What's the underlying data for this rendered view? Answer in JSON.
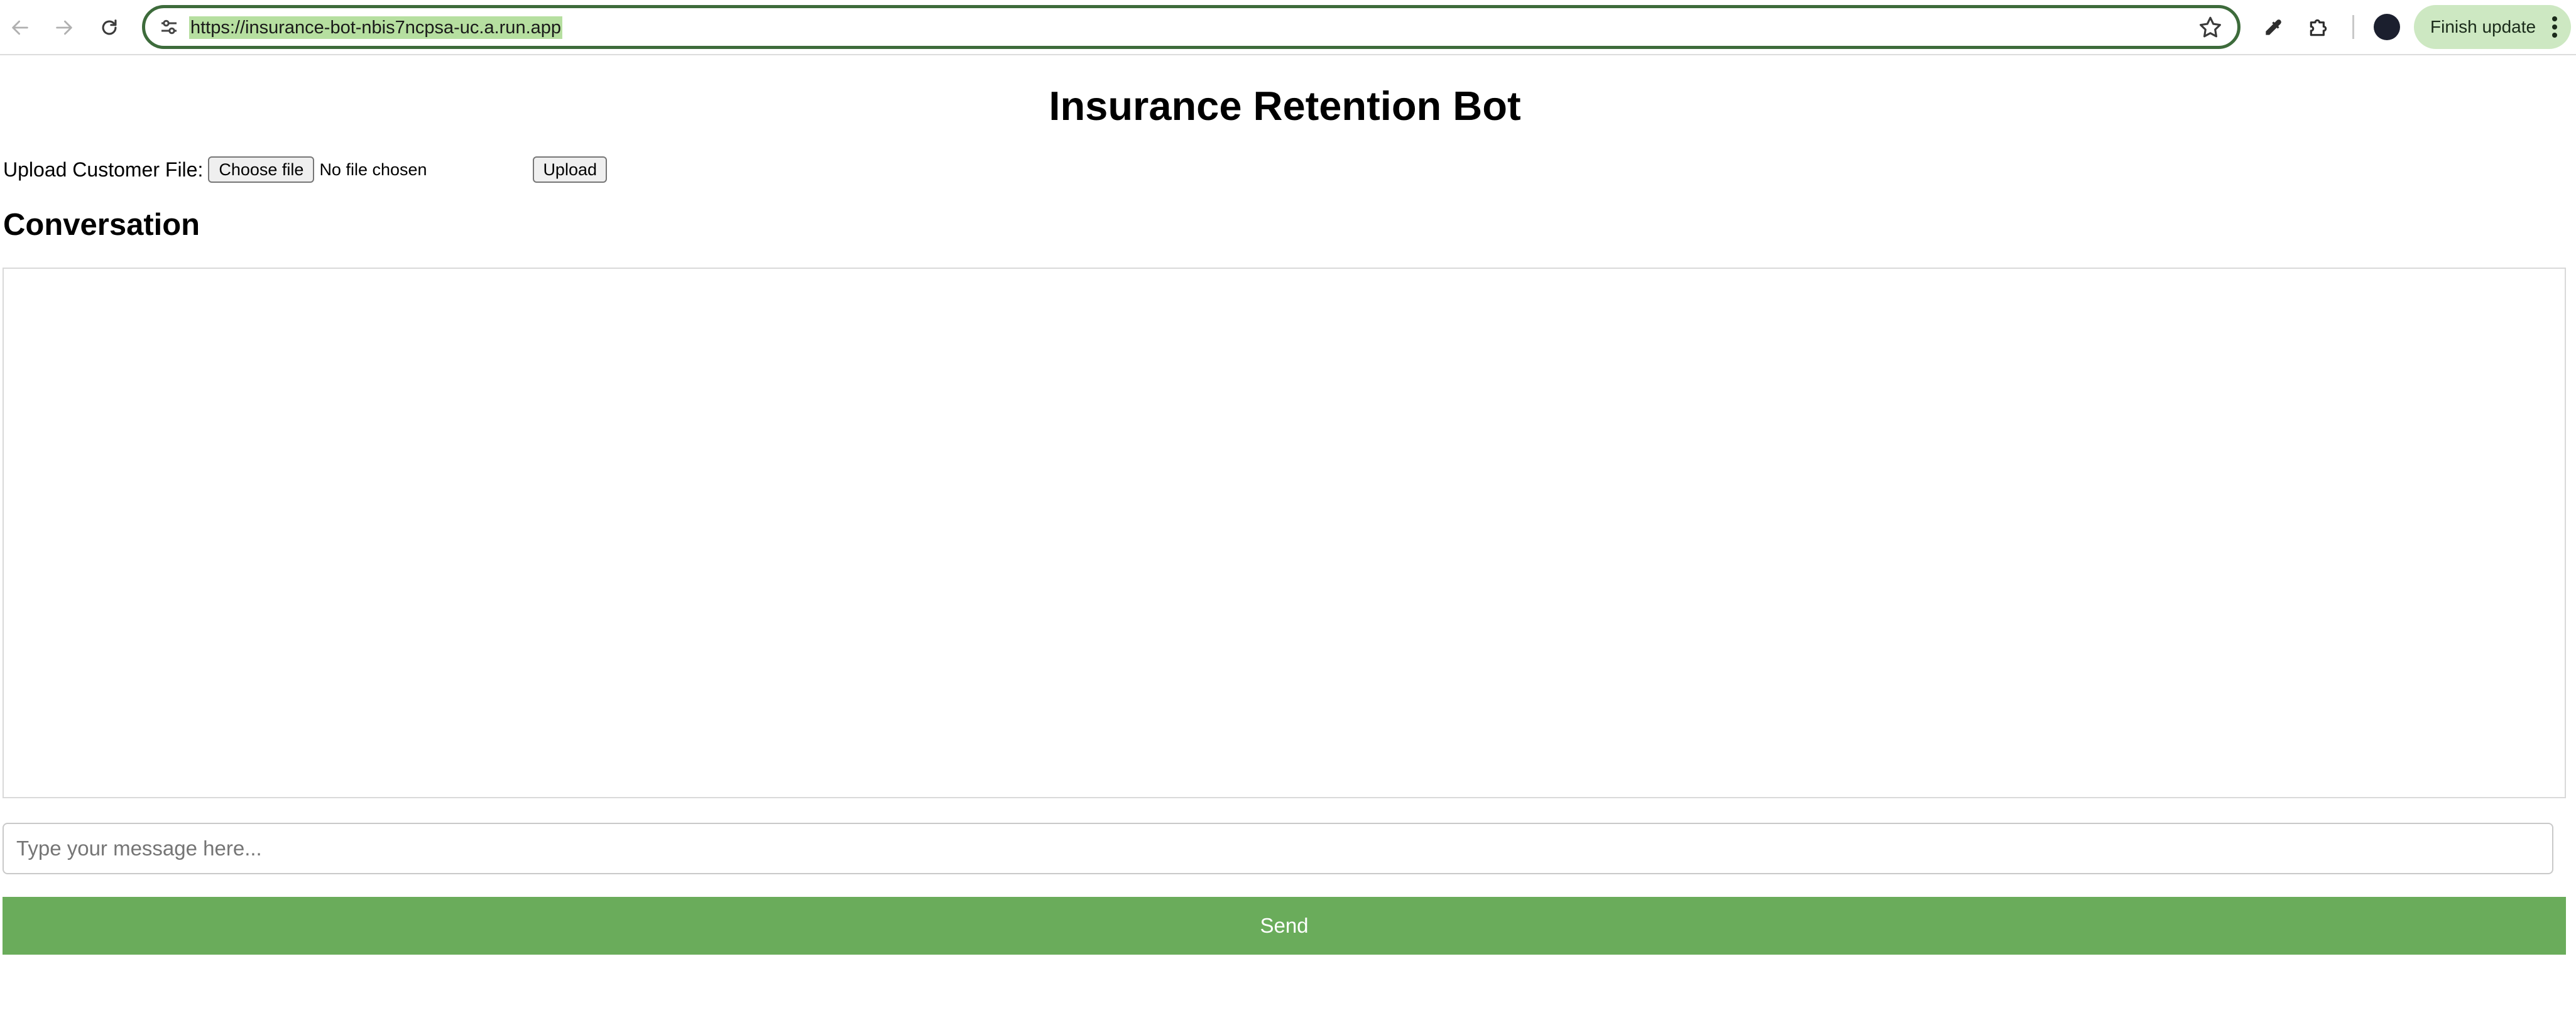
{
  "browser": {
    "url": "https://insurance-bot-nbis7ncpsa-uc.a.run.app",
    "update_button_label": "Finish update",
    "icons": [
      "back-arrow-icon",
      "forward-arrow-icon",
      "reload-icon",
      "site-info-icon",
      "bookmark-star-icon",
      "eyedropper-icon",
      "extensions-puzzle-icon",
      "profile-avatar-icon",
      "more-menu-icon"
    ]
  },
  "page": {
    "title": "Insurance Retention Bot",
    "upload": {
      "label": "Upload Customer File:",
      "choose_button": "Choose file",
      "file_status": "No file chosen",
      "upload_button": "Upload"
    },
    "conversation_heading": "Conversation",
    "message_placeholder": "Type your message here...",
    "send_button": "Send"
  },
  "colors": {
    "send_button_bg": "#6aac5b",
    "omnibox_border": "#3d6b3b",
    "url_highlight": "#b6dfa0",
    "update_pill_bg": "#cde8c2"
  }
}
